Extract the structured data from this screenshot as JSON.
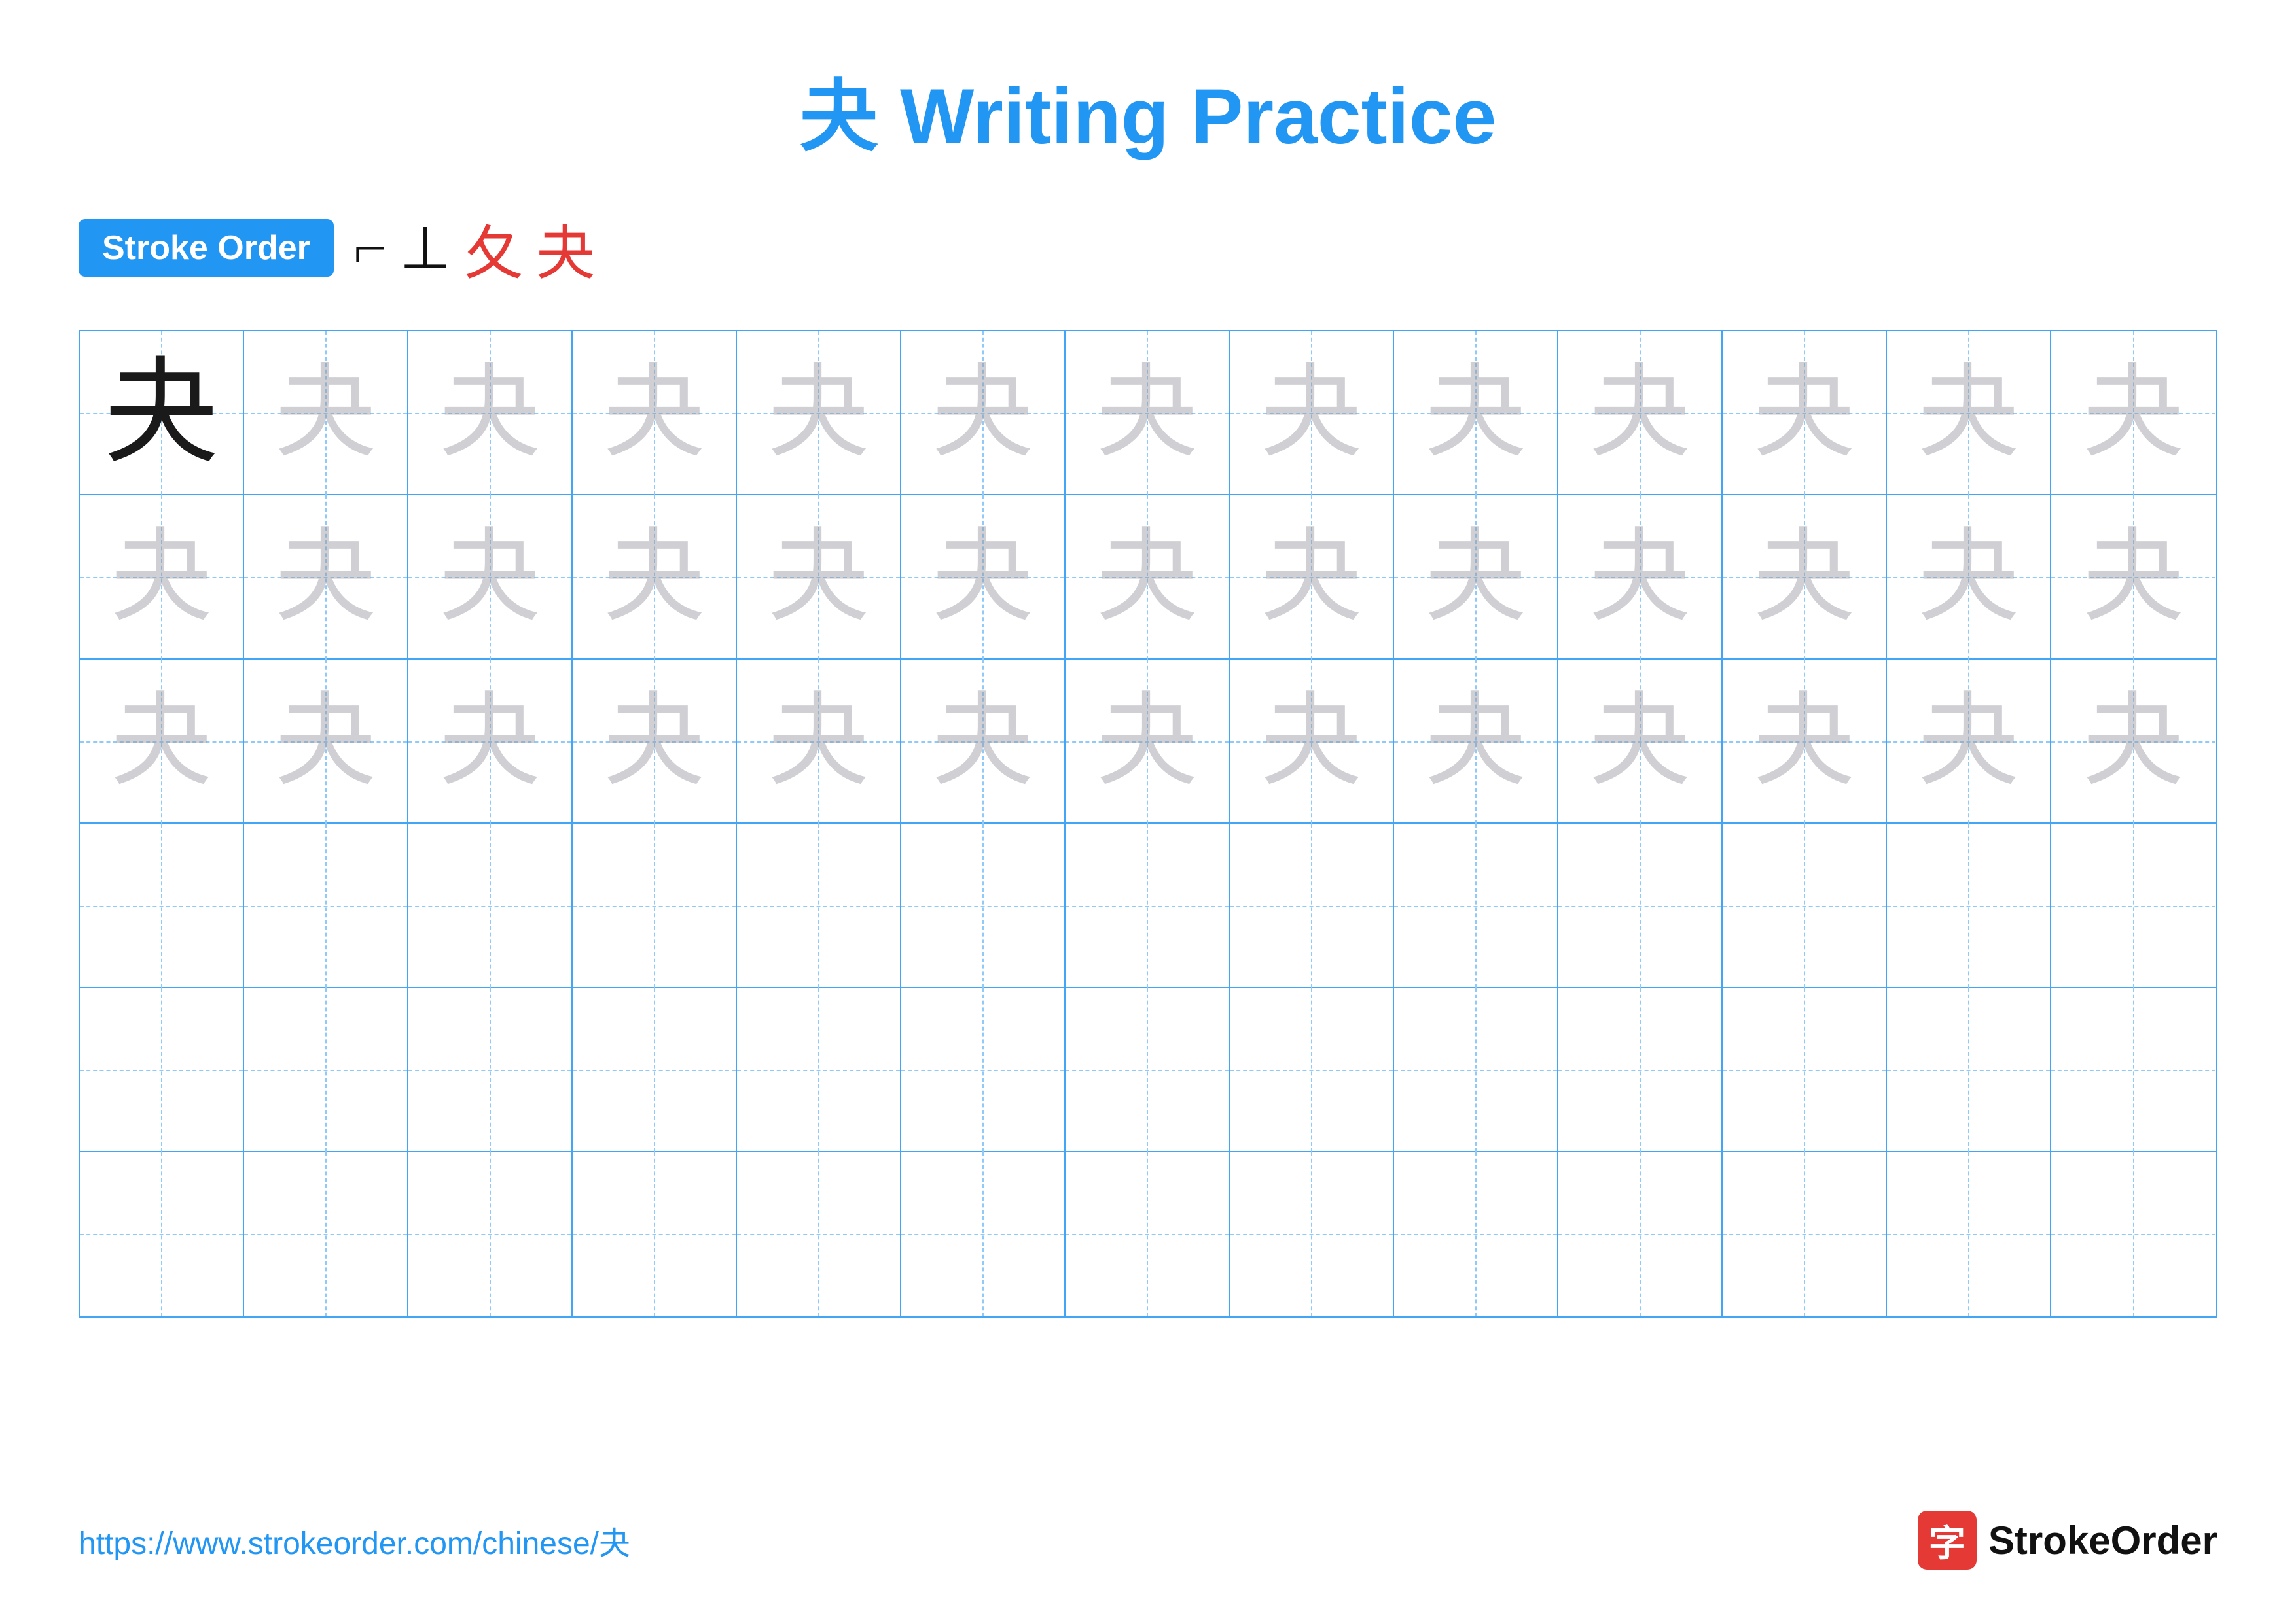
{
  "title": {
    "char": "夬",
    "text": " Writing Practice"
  },
  "stroke_order": {
    "badge_label": "Stroke Order",
    "strokes": [
      "⌐",
      "⊥",
      "⺔",
      "夬"
    ]
  },
  "grid": {
    "rows": 6,
    "cols": 13,
    "char": "夬",
    "solid_row": 0,
    "solid_col": 0,
    "light_rows": [
      0,
      1,
      2
    ]
  },
  "footer": {
    "url": "https://www.strokeorder.com/chinese/夬",
    "logo_char": "字",
    "logo_text": "StrokeOrder"
  }
}
